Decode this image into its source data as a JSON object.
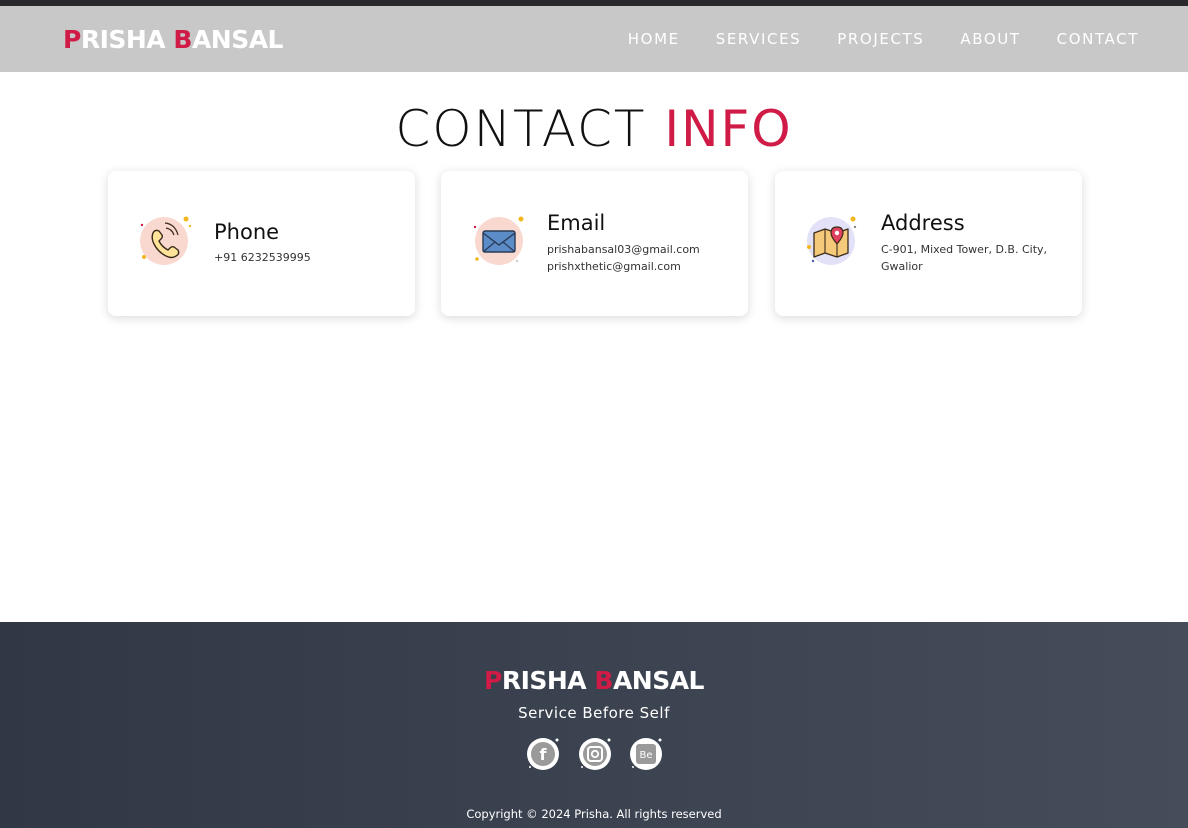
{
  "header": {
    "logo": {
      "first_initial": "P",
      "first_rest": "RISHA ",
      "last_initial": "B",
      "last_rest": "ANSAL"
    },
    "nav": [
      "HOME",
      "SERVICES",
      "PROJECTS",
      "ABOUT",
      "CONTACT"
    ]
  },
  "section": {
    "title_main": "CONTACT ",
    "title_accent": "INFO"
  },
  "cards": [
    {
      "icon": "phone-icon",
      "title": "Phone",
      "lines": [
        "+91 6232539995"
      ]
    },
    {
      "icon": "mail-icon",
      "title": "Email",
      "lines": [
        "prishabansal03@gmail.com",
        "prishxthetic@gmail.com"
      ]
    },
    {
      "icon": "map-pin-icon",
      "title": "Address",
      "lines": [
        "C-901, Mixed Tower, D.B. City,",
        "Gwalior"
      ]
    }
  ],
  "footer": {
    "logo": {
      "first_initial": "P",
      "first_rest": "RISHA ",
      "last_initial": "B",
      "last_rest": "ANSAL"
    },
    "tagline": "Service Before Self",
    "socials": [
      {
        "icon": "facebook-icon",
        "glyph": "f"
      },
      {
        "icon": "instagram-icon",
        "glyph": ""
      },
      {
        "icon": "behance-icon",
        "glyph": "Be"
      }
    ],
    "copyright": "Copyright © 2024 Prisha. All rights reserved"
  },
  "colors": {
    "accent": "#d01b47",
    "navbar": "#c8c8c8",
    "footer": "#3b4250"
  }
}
